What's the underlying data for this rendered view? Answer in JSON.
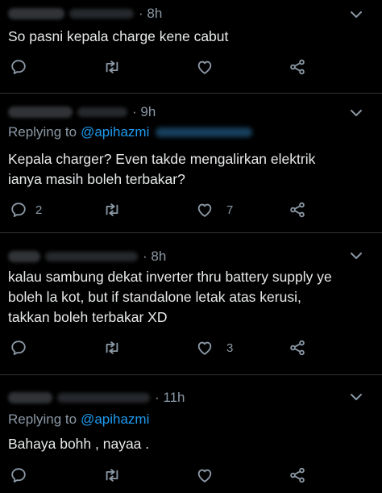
{
  "tweets": [
    {
      "time": "· 8h",
      "replying_prefix": "",
      "replying_mention": "",
      "text": "So pasni kepala charge kene cabut",
      "reply_count": "",
      "like_count": ""
    },
    {
      "time": "· 9h",
      "replying_prefix": "Replying to",
      "replying_mention": "@apihazmi",
      "text": "Kepala charger? Even takde mengalirkan elektrik\nianya masih boleh terbakar?",
      "reply_count": "2",
      "like_count": "7"
    },
    {
      "time": "· 8h",
      "replying_prefix": "",
      "replying_mention": "",
      "text": "kalau sambung dekat inverter thru battery supply ye\nboleh la kot, but if standalone letak atas kerusi,\ntakkan boleh terbakar XD",
      "reply_count": "",
      "like_count": "3"
    },
    {
      "time": "· 11h",
      "replying_prefix": "Replying to",
      "replying_mention": "@apihazmi",
      "text": "Bahaya bohh , nayaa .",
      "reply_count": "",
      "like_count": ""
    }
  ],
  "colors": {
    "background": "#000000",
    "text": "#e7e9ea",
    "muted": "#8b98a5",
    "link": "#1d9bf0",
    "divider": "#2f3336"
  },
  "icons": [
    "reply-icon",
    "retweet-icon",
    "like-icon",
    "share-icon",
    "more-icon"
  ]
}
